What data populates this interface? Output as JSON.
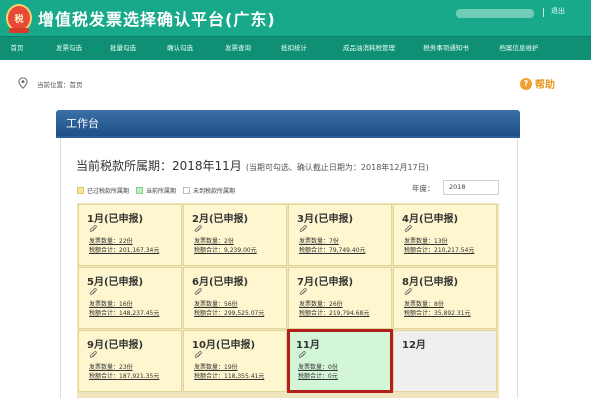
{
  "app": {
    "title": "增值税发票选择确认平台(广东)",
    "logo_text": "税",
    "logout": "退出"
  },
  "nav": [
    {
      "label": "首页",
      "active": true
    },
    {
      "label": "发票勾选"
    },
    {
      "label": "批量勾选"
    },
    {
      "label": "确认勾选"
    },
    {
      "label": "发票查询"
    },
    {
      "label": "抵扣统计"
    },
    {
      "label": "成品油消耗税管理"
    },
    {
      "label": "税务事项通知书"
    },
    {
      "label": "档案信息维护"
    }
  ],
  "breadcrumb": "当前位置：首页",
  "help_label": "帮助",
  "panel": {
    "title": "工作台",
    "period_main": "当前税款所属期：2018年11月",
    "period_note": "(当期可勾选、确认截止日期为：2018年12月17日)",
    "legend": [
      {
        "label": "已过税款所属期",
        "color": "#f6e3a0"
      },
      {
        "label": "当前所属期",
        "color": "#bff0c4"
      },
      {
        "label": "未到税款所属期",
        "color": "#ffffff"
      }
    ],
    "year_label": "年度：",
    "year_value": "2018"
  },
  "months": [
    {
      "title": "1月(已申报)",
      "count": "发票数量：22份",
      "tax": "税额合计：201,167.34元",
      "status": "reported"
    },
    {
      "title": "2月(已申报)",
      "count": "发票数量：2份",
      "tax": "税额合计：9,239.00元",
      "status": "reported"
    },
    {
      "title": "3月(已申报)",
      "count": "发票数量：7份",
      "tax": "税额合计：79,749.40元",
      "status": "reported"
    },
    {
      "title": "4月(已申报)",
      "count": "发票数量：13份",
      "tax": "税额合计：210,217.54元",
      "status": "reported"
    },
    {
      "title": "5月(已申报)",
      "count": "发票数量：16份",
      "tax": "税额合计：148,237.45元",
      "status": "reported"
    },
    {
      "title": "6月(已申报)",
      "count": "发票数量：56份",
      "tax": "税额合计：299,525.07元",
      "status": "reported"
    },
    {
      "title": "7月(已申报)",
      "count": "发票数量：26份",
      "tax": "税额合计：219,794.68元",
      "status": "reported"
    },
    {
      "title": "8月(已申报)",
      "count": "发票数量：8份",
      "tax": "税额合计：35,892.31元",
      "status": "reported"
    },
    {
      "title": "9月(已申报)",
      "count": "发票数量：23份",
      "tax": "税额合计：187,921.35元",
      "status": "reported"
    },
    {
      "title": "10月(已申报)",
      "count": "发票数量：19份",
      "tax": "税额合计：118,355.41元",
      "status": "reported"
    },
    {
      "title": "11月",
      "count": "发票数量：0份",
      "tax": "税额合计：0元",
      "status": "current"
    },
    {
      "title": "12月",
      "status": "future"
    }
  ]
}
